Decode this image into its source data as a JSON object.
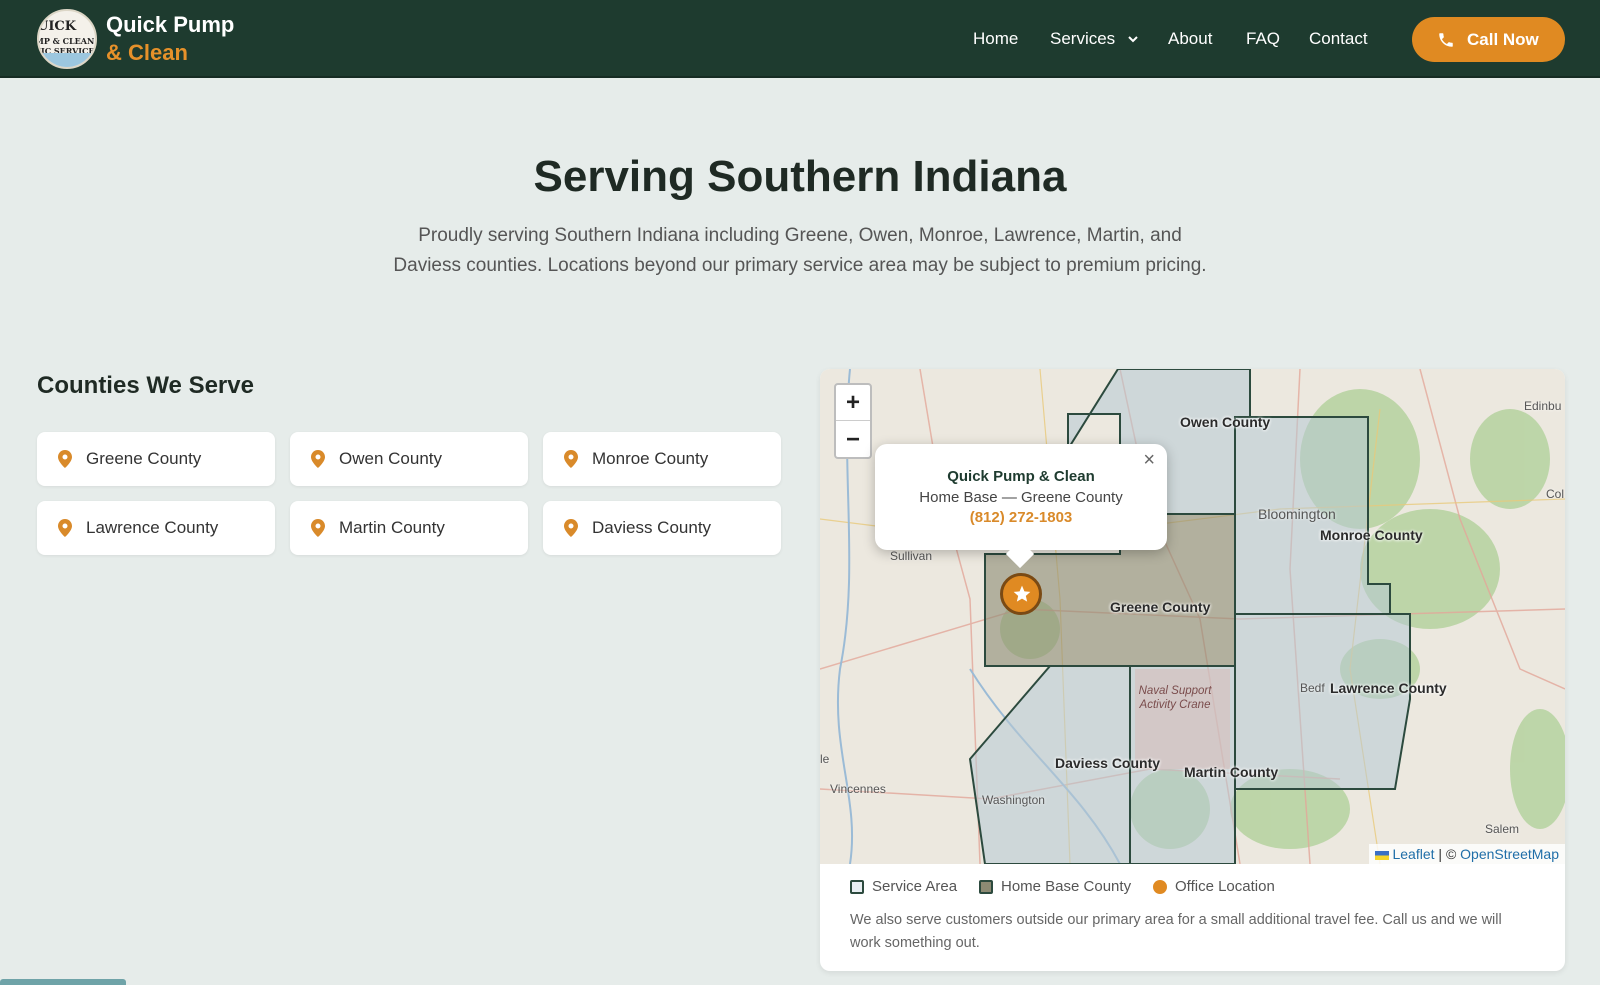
{
  "nav": {
    "logo_text": [
      "UICK",
      "MP & CLEAN",
      "TIC SERVICE"
    ],
    "brand_line1": "Quick Pump",
    "brand_line2": "& Clean",
    "links": [
      "Home",
      "Services",
      "About",
      "FAQ",
      "Contact"
    ],
    "cta_label": "Call Now",
    "cta_icon": "phone-icon"
  },
  "hero": {
    "title": "Serving Southern Indiana",
    "subtitle": "Proudly serving Southern Indiana including Greene, Owen, Monroe, Lawrence, Martin, and Daviess counties. Locations beyond our primary service area may be subject to premium pricing."
  },
  "counties": {
    "title": "Counties We Serve",
    "items": [
      "Greene County",
      "Owen County",
      "Monroe County",
      "Lawrence County",
      "Martin County",
      "Daviess County"
    ],
    "icon": "map-pin-icon"
  },
  "map": {
    "popup": {
      "title": "Quick Pump & Clean",
      "subtitle": "Home Base — Greene County",
      "phone": "(812) 272-1803"
    },
    "county_labels": [
      "Owen County",
      "Monroe County",
      "Greene County",
      "Lawrence County",
      "Daviess County",
      "Martin County"
    ],
    "towns": [
      "Edinbu",
      "Col",
      "Bloomington",
      "Sullivan",
      "Bedf",
      "Vincennes",
      "Washington",
      "Salem",
      "le"
    ],
    "naval_label": "Naval Support Activity Crane",
    "attribution": {
      "leaflet": "Leaflet",
      "separator": "| ©",
      "osm": "OpenStreetMap"
    },
    "zoom_in": "+",
    "zoom_out": "−",
    "close_glyph": "×",
    "colors": {
      "service_area": "#b7c8d4",
      "home_base": "#8c8a73",
      "office": "#e08a22",
      "border": "#2c4a3e"
    }
  },
  "legend": {
    "service_area": "Service Area",
    "home_base": "Home Base County",
    "office": "Office Location"
  },
  "note": "We also serve customers outside our primary area for a small additional travel fee. Call us and we will work something out.",
  "theme": {
    "nav_bg": "#1e3b2f",
    "accent": "#e08a22",
    "page_bg": "#e6ecea"
  }
}
